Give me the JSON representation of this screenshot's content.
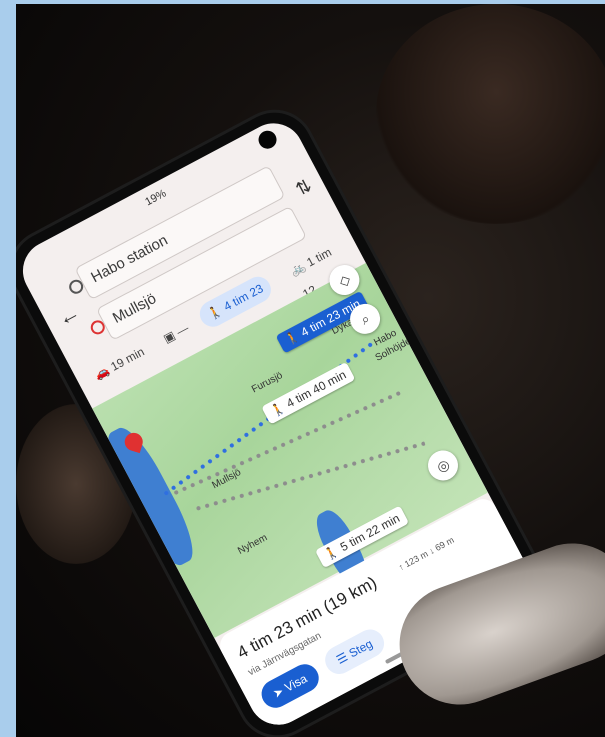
{
  "status_bar": {
    "battery": "19%"
  },
  "directions": {
    "origin": "Habo station",
    "destination": "Mullsjö",
    "back_icon": "arrow-left-icon",
    "swap_icon": "swap-vertical-icon"
  },
  "modes": [
    {
      "icon": "car-icon",
      "label": "19 min",
      "active": false
    },
    {
      "icon": "transit-icon",
      "label": "—",
      "active": false
    },
    {
      "icon": "walk-icon",
      "label": "4 tim 23",
      "active": true
    },
    {
      "icon": "bike-icon",
      "label": "1 tim 12",
      "active": false
    }
  ],
  "map": {
    "places": [
      "Furusjö",
      "Dykarp",
      "Habo",
      "Solhöjden",
      "Mullsjö",
      "Nyhem"
    ],
    "route_labels": {
      "primary": "4 tim 23 min",
      "alt1": "4 tim 40 min",
      "alt2": "5 tim 22 min"
    },
    "accent_color": "#1a5fd1",
    "pin_color": "#e03131"
  },
  "sheet": {
    "title": "4 tim 23 min (19 km)",
    "elevation_up": "↑ 123 m",
    "elevation_down": "↓ 69 m",
    "via": "via Järnvägsgatan",
    "primary_button": "Visa",
    "secondary_button": "Steg"
  }
}
